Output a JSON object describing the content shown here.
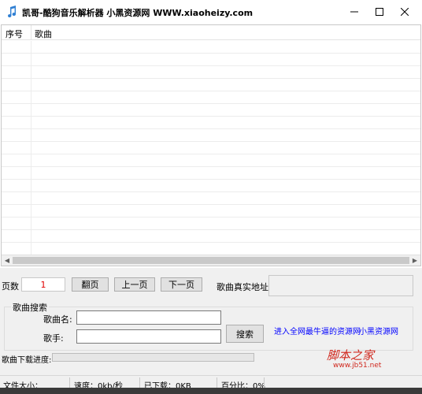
{
  "titlebar": {
    "title": "凯哥-酷狗音乐解析器        小黑资源网 WWW.xiaoheizy.com",
    "icon": "music-note-icon"
  },
  "list": {
    "columns": [
      "序号",
      "歌曲"
    ],
    "rows": []
  },
  "pager": {
    "page_label": "页数",
    "page_value": "1",
    "flip_label": "翻页",
    "prev_label": "上一页",
    "next_label": "下一页",
    "real_url_label": "歌曲真实地址:"
  },
  "search": {
    "group_title": "歌曲搜索",
    "song_label": "歌曲名:",
    "song_value": "",
    "singer_label": "歌手:",
    "singer_value": "",
    "search_label": "搜索",
    "link_best": "进入全网最牛逼的资源网",
    "link_site": "小黑资源网"
  },
  "download": {
    "progress_label": "歌曲下载进度:",
    "progress": 0
  },
  "status": {
    "file_size": "文件大小：",
    "speed": "速度：0kb/秒",
    "downloaded": "已下载：0KB",
    "percent": "百分比：0%"
  },
  "watermark": {
    "main": "脚本之家",
    "sub": "www.jb51.net"
  },
  "colors": {
    "page_value": "#e00000",
    "link": "#0000ff",
    "watermark": "#d0281e"
  }
}
